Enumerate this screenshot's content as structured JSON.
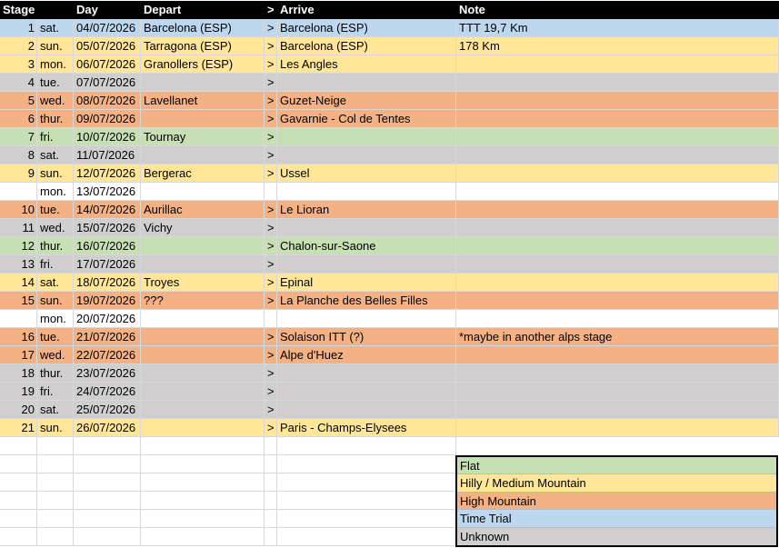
{
  "headers": {
    "stage": "Stage",
    "day": "Day",
    "depart": "Depart",
    "arrow": ">",
    "arrive": "Arrive",
    "note": "Note"
  },
  "rows": [
    {
      "stage": "1",
      "dow": "sat.",
      "date": "04/07/2026",
      "depart": "Barcelona (ESP)",
      "arrow": ">",
      "arrive": "Barcelona (ESP)",
      "note": "TTT 19,7 Km",
      "type": "tt"
    },
    {
      "stage": "2",
      "dow": "sun.",
      "date": "05/07/2026",
      "depart": "Tarragona (ESP)",
      "arrow": ">",
      "arrive": "Barcelona (ESP)",
      "note": "178 Km",
      "type": "hilly"
    },
    {
      "stage": "3",
      "dow": "mon.",
      "date": "06/07/2026",
      "depart": "Granollers (ESP)",
      "arrow": ">",
      "arrive": "Les Angles",
      "note": "",
      "type": "hilly"
    },
    {
      "stage": "4",
      "dow": "tue.",
      "date": "07/07/2026",
      "depart": "",
      "arrow": ">",
      "arrive": "",
      "note": "",
      "type": "unk"
    },
    {
      "stage": "5",
      "dow": "wed.",
      "date": "08/07/2026",
      "depart": "Lavellanet",
      "arrow": ">",
      "arrive": "Guzet-Neige",
      "note": "",
      "type": "high"
    },
    {
      "stage": "6",
      "dow": "thur.",
      "date": "09/07/2026",
      "depart": "",
      "arrow": ">",
      "arrive": "Gavarnie - Col de Tentes",
      "note": "",
      "type": "high"
    },
    {
      "stage": "7",
      "dow": "fri.",
      "date": "10/07/2026",
      "depart": "Tournay",
      "arrow": ">",
      "arrive": "",
      "note": "",
      "type": "flat"
    },
    {
      "stage": "8",
      "dow": "sat.",
      "date": "11/07/2026",
      "depart": "",
      "arrow": ">",
      "arrive": "",
      "note": "",
      "type": "unk"
    },
    {
      "stage": "9",
      "dow": "sun.",
      "date": "12/07/2026",
      "depart": "Bergerac",
      "arrow": ">",
      "arrive": "Ussel",
      "note": "",
      "type": "hilly"
    },
    {
      "stage": "",
      "dow": "mon.",
      "date": "13/07/2026",
      "depart": "",
      "arrow": "",
      "arrive": "",
      "note": "",
      "type": "white"
    },
    {
      "stage": "10",
      "dow": "tue.",
      "date": "14/07/2026",
      "depart": "Aurillac",
      "arrow": ">",
      "arrive": "Le Lioran",
      "note": "",
      "type": "high"
    },
    {
      "stage": "11",
      "dow": "wed.",
      "date": "15/07/2026",
      "depart": "Vichy",
      "arrow": ">",
      "arrive": "",
      "note": "",
      "type": "unk"
    },
    {
      "stage": "12",
      "dow": "thur.",
      "date": "16/07/2026",
      "depart": "",
      "arrow": ">",
      "arrive": "Chalon-sur-Saone",
      "note": "",
      "type": "flat"
    },
    {
      "stage": "13",
      "dow": "fri.",
      "date": "17/07/2026",
      "depart": "",
      "arrow": ">",
      "arrive": "",
      "note": "",
      "type": "unk"
    },
    {
      "stage": "14",
      "dow": "sat.",
      "date": "18/07/2026",
      "depart": "Troyes",
      "arrow": ">",
      "arrive": "Epinal",
      "note": "",
      "type": "hilly"
    },
    {
      "stage": "15",
      "dow": "sun.",
      "date": "19/07/2026",
      "depart": "???",
      "arrow": ">",
      "arrive": "La Planche des Belles Filles",
      "note": "",
      "type": "high"
    },
    {
      "stage": "",
      "dow": "mon.",
      "date": "20/07/2026",
      "depart": "",
      "arrow": "",
      "arrive": "",
      "note": "",
      "type": "white"
    },
    {
      "stage": "16",
      "dow": "tue.",
      "date": "21/07/2026",
      "depart": "",
      "arrow": ">",
      "arrive": "Solaison ITT (?)",
      "note": "*maybe in another alps stage",
      "type": "high"
    },
    {
      "stage": "17",
      "dow": "wed.",
      "date": "22/07/2026",
      "depart": "",
      "arrow": ">",
      "arrive": "Alpe d'Huez",
      "note": "",
      "type": "high"
    },
    {
      "stage": "18",
      "dow": "thur.",
      "date": "23/07/2026",
      "depart": "",
      "arrow": ">",
      "arrive": "",
      "note": "",
      "type": "unk"
    },
    {
      "stage": "19",
      "dow": "fri.",
      "date": "24/07/2026",
      "depart": "",
      "arrow": ">",
      "arrive": "",
      "note": "",
      "type": "unk"
    },
    {
      "stage": "20",
      "dow": "sat.",
      "date": "25/07/2026",
      "depart": "",
      "arrow": ">",
      "arrive": "",
      "note": "",
      "type": "unk"
    },
    {
      "stage": "21",
      "dow": "sun.",
      "date": "26/07/2026",
      "depart": "",
      "arrow": ">",
      "arrive": "Paris - Champs-Elysees",
      "note": "",
      "type": "hilly"
    }
  ],
  "legend": [
    {
      "label": "Flat",
      "type": "flat"
    },
    {
      "label": "Hilly / Medium Mountain",
      "type": "hilly"
    },
    {
      "label": "High Mountain",
      "type": "high"
    },
    {
      "label": "Time Trial",
      "type": "tt"
    },
    {
      "label": "Unknown",
      "type": "unk"
    }
  ],
  "colors": {
    "flat": "#c6e0b4",
    "hilly": "#ffe699",
    "high": "#f4b183",
    "tt": "#bdd7ee",
    "unk": "#d0cece",
    "header": "#000000"
  }
}
